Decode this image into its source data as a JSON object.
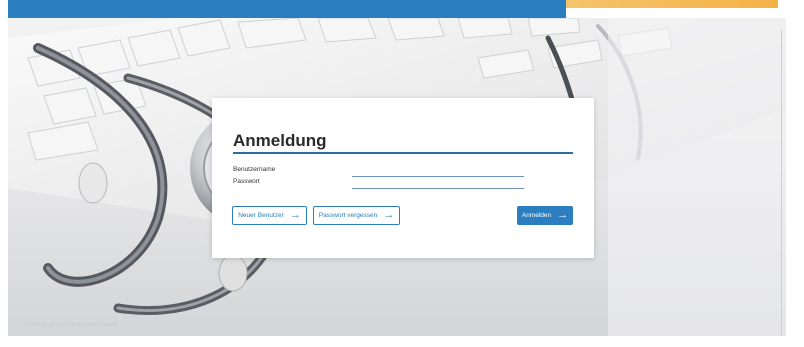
{
  "login": {
    "title": "Anmeldung",
    "username_label": "Benutzername",
    "username_value": "",
    "password_label": "Passwort",
    "password_value": "",
    "new_user_label": "Neuer Benutzer",
    "forgot_password_label": "Passwort vergessen",
    "submit_label": "Anmelden",
    "arrow_icon": "→"
  },
  "footer": {
    "image_credit": "© Fotolia, gfxxx / iStock Getty Images"
  },
  "colors": {
    "accent_blue": "#2b7fc0",
    "accent_orange": "#f3b247",
    "title_rule": "#2b6f9e"
  }
}
